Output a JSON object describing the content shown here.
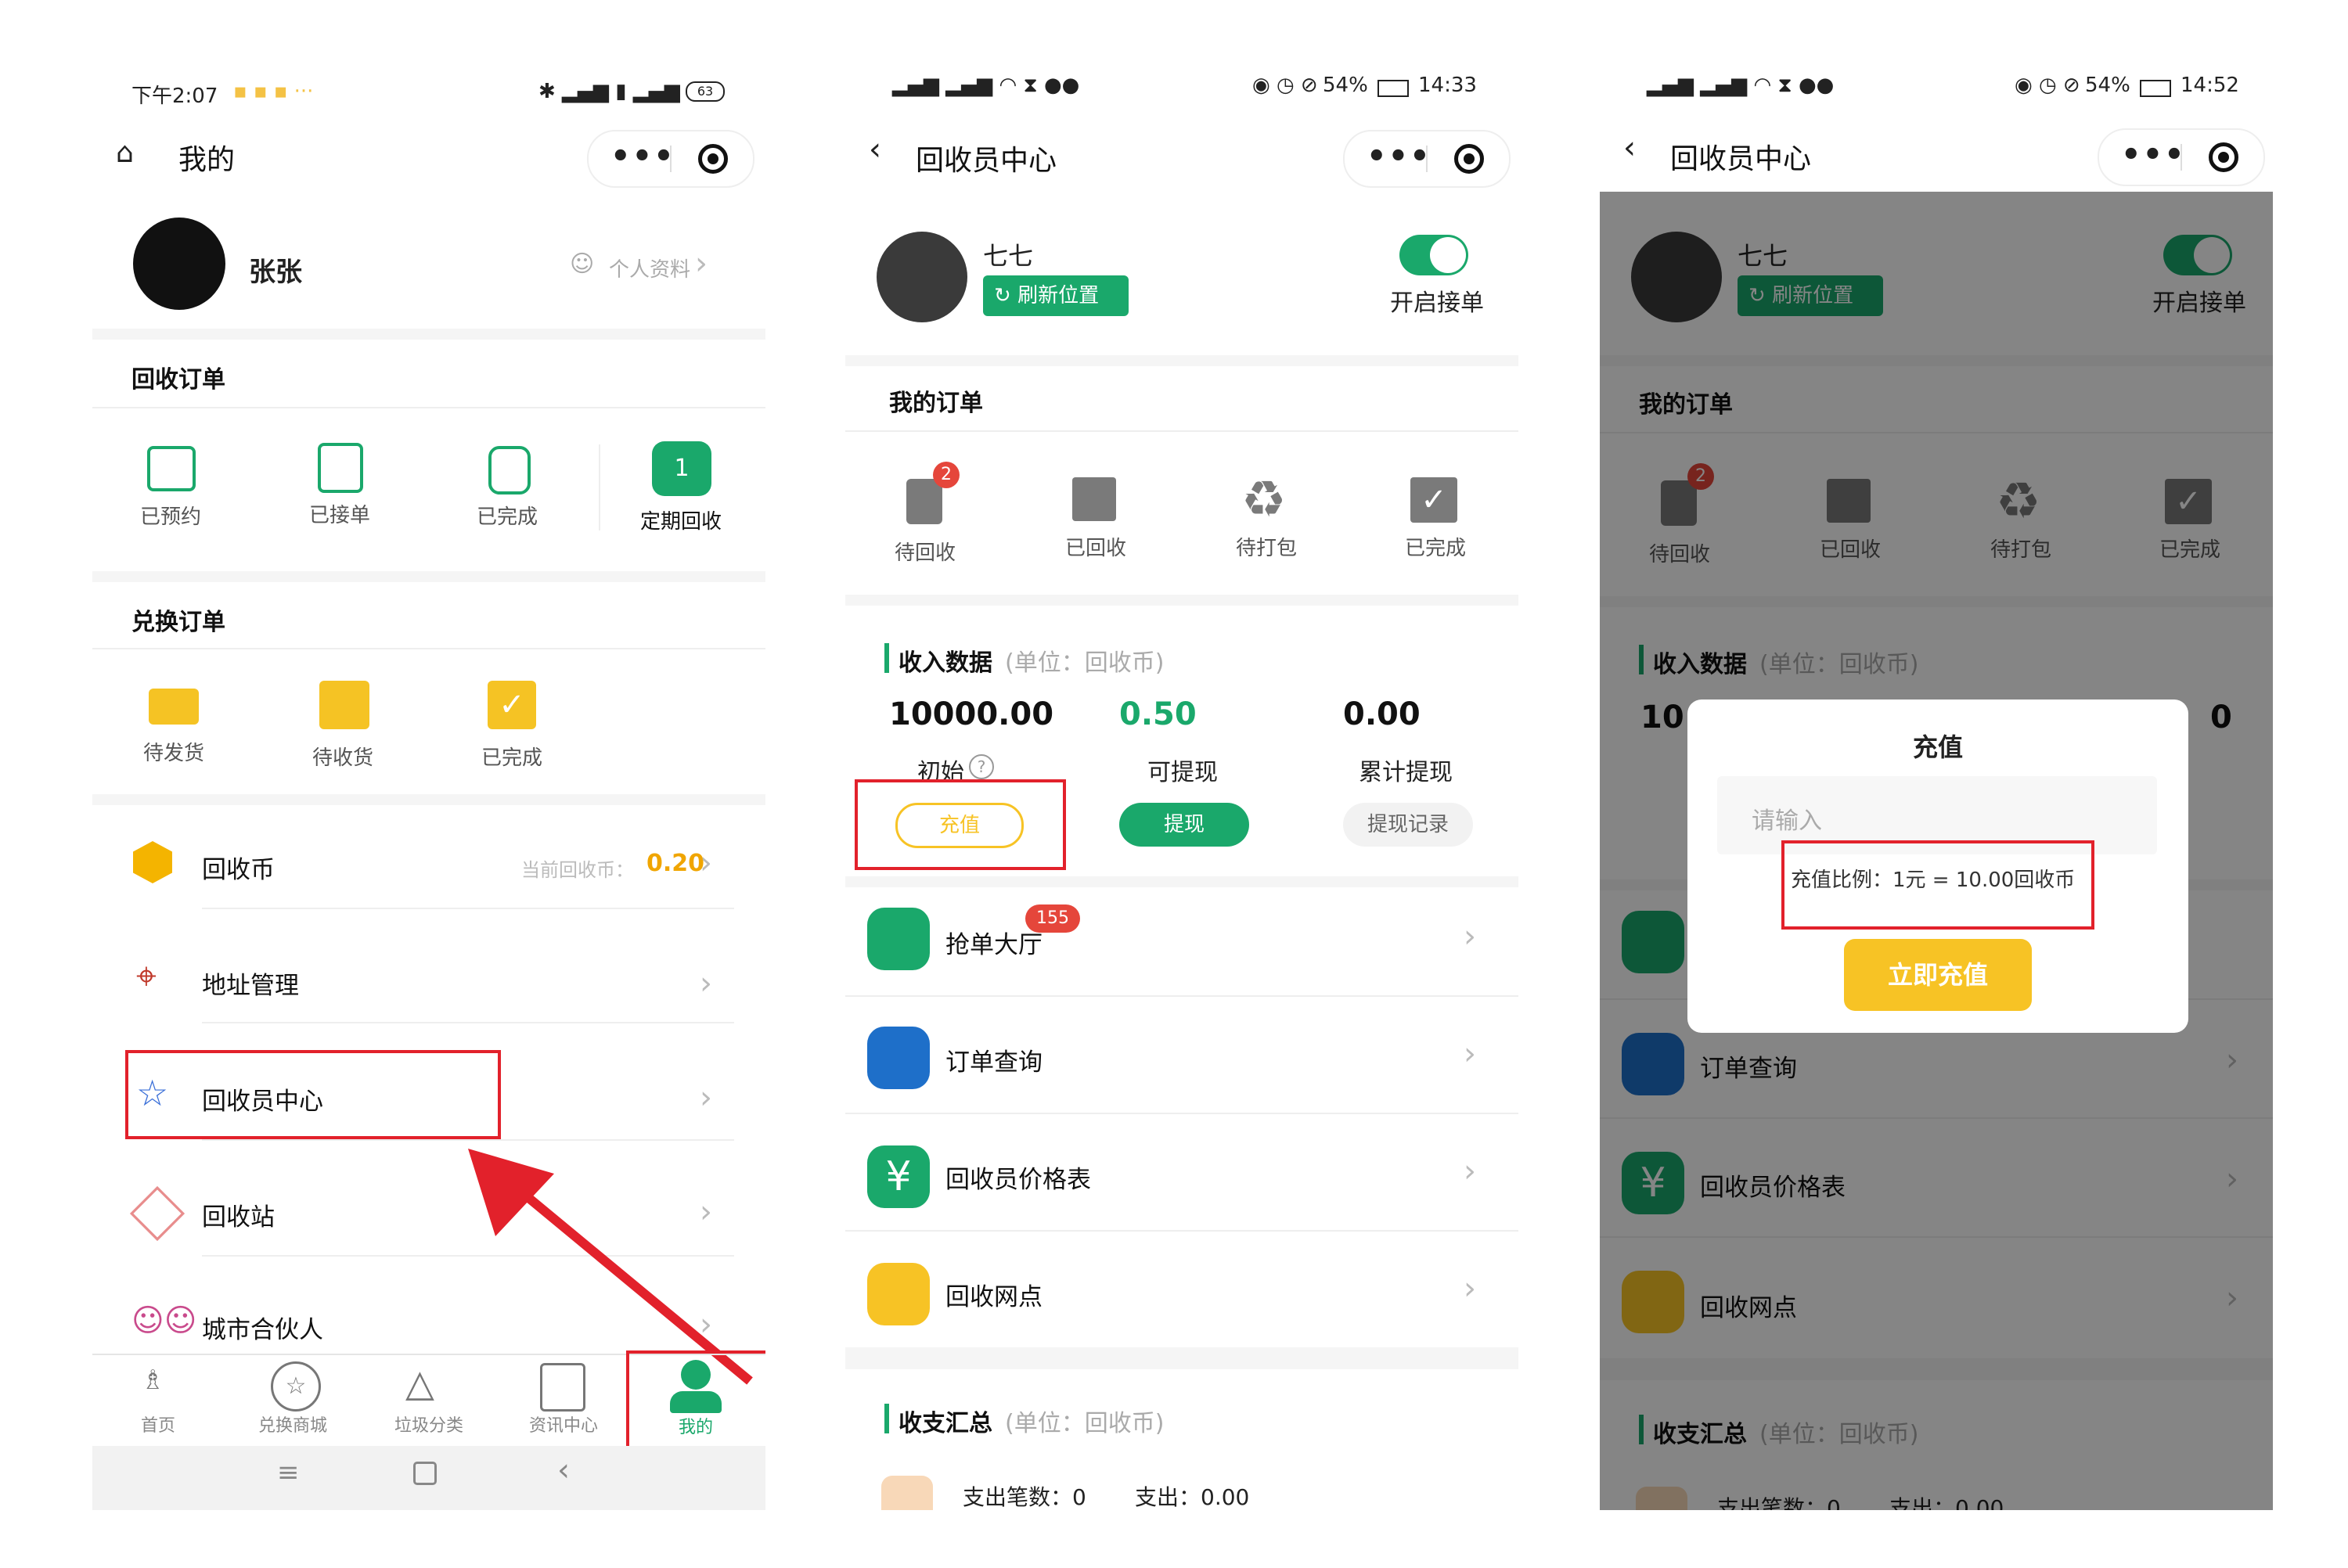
{
  "panel1": {
    "status_time": "下午2:07",
    "status_right": "63",
    "nav_title": "我的",
    "user_name": "张张",
    "profile_link": "个人资料",
    "recycle_orders_title": "回收订单",
    "recycle_orders": [
      "已预约",
      "已接单",
      "已完成",
      "定期回收"
    ],
    "exchange_orders_title": "兑换订单",
    "exchange_orders": [
      "待发货",
      "待收货",
      "已完成"
    ],
    "coin_label": "回收币",
    "coin_current_label": "当前回收币：",
    "coin_current_value": "0.20",
    "menu": [
      "地址管理",
      "回收员中心",
      "回收站",
      "城市合伙人"
    ],
    "tabs": [
      "首页",
      "兑换商城",
      "垃圾分类",
      "资讯中心",
      "我的"
    ]
  },
  "panel2": {
    "status_left": "46 46",
    "status_right": "54%",
    "status_time": "14:33",
    "nav_title": "回收员中心",
    "user_name": "七七",
    "refresh_button": "刷新位置",
    "toggle_label": "开启接单",
    "my_orders_title": "我的订单",
    "order_badge": "2",
    "orders": [
      "待回收",
      "已回收",
      "待打包",
      "已完成"
    ],
    "income_title": "收入数据",
    "income_unit": "(单位：回收币)",
    "income_values": [
      "10000.00",
      "0.50",
      "0.00"
    ],
    "income_labels": [
      "初始",
      "可提现",
      "累计提现"
    ],
    "income_buttons": [
      "充值",
      "提现",
      "提现记录"
    ],
    "menu": [
      "抢单大厅",
      "订单查询",
      "回收员价格表",
      "回收网点"
    ],
    "hall_badge": "155",
    "summary_title": "收支汇总",
    "summary_unit": "(单位：回收币)",
    "summary_count": "支出笔数：0",
    "summary_out": "支出：0.00"
  },
  "panel3": {
    "status_right": "54%",
    "status_time": "14:52",
    "nav_title": "回收员中心",
    "user_name": "七七",
    "refresh_button": "刷新位置",
    "toggle_label": "开启接单",
    "my_orders_title": "我的订单",
    "order_badge": "2",
    "orders": [
      "待回收",
      "已回收",
      "待打包",
      "已完成"
    ],
    "income_title": "收入数据",
    "income_unit": "(单位：回收币)",
    "income_partial": "10",
    "income_partial_right": "0",
    "menu": [
      "订单查询",
      "回收员价格表",
      "回收网点"
    ],
    "summary_title": "收支汇总",
    "summary_unit": "(单位：回收币)",
    "summary_count": "支出笔数：0",
    "summary_out": "支出：0.00",
    "dialog": {
      "title": "充值",
      "placeholder": "请输入",
      "ratio": "充值比例：1元 = 10.00回收币",
      "submit": "立即充值"
    }
  },
  "colors": {
    "green": "#1aa86b",
    "yellow": "#f7c325",
    "red_box": "#e2212b",
    "coin_orange": "#f0a500"
  }
}
